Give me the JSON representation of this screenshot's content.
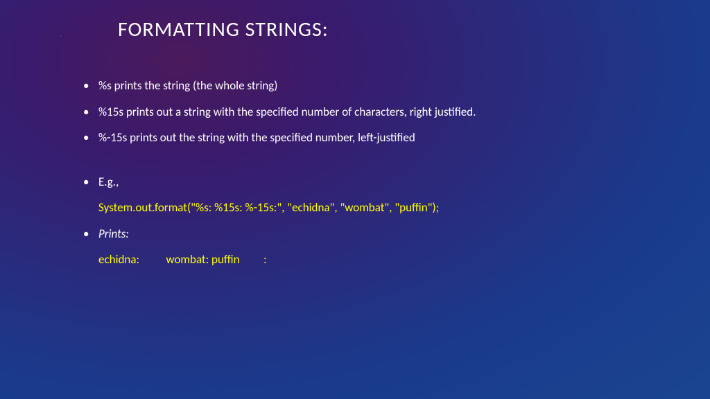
{
  "title": "FORMATTING STRINGS:",
  "bullets": {
    "b1": "%s prints the string (the whole string)",
    "b2": "%15s prints out a string with the specified number of characters, right justified.",
    "b3": "%-15s prints out the string with the specified number, left-justified",
    "b4": "E.g.,",
    "b5": "Prints:"
  },
  "code": "System.out.format(\"%s: %15s: %-15s:\", \"echidna\", \"wombat\", \"puffin\");",
  "output": "echidna:          wombat: puffin         :",
  "marker": "•"
}
